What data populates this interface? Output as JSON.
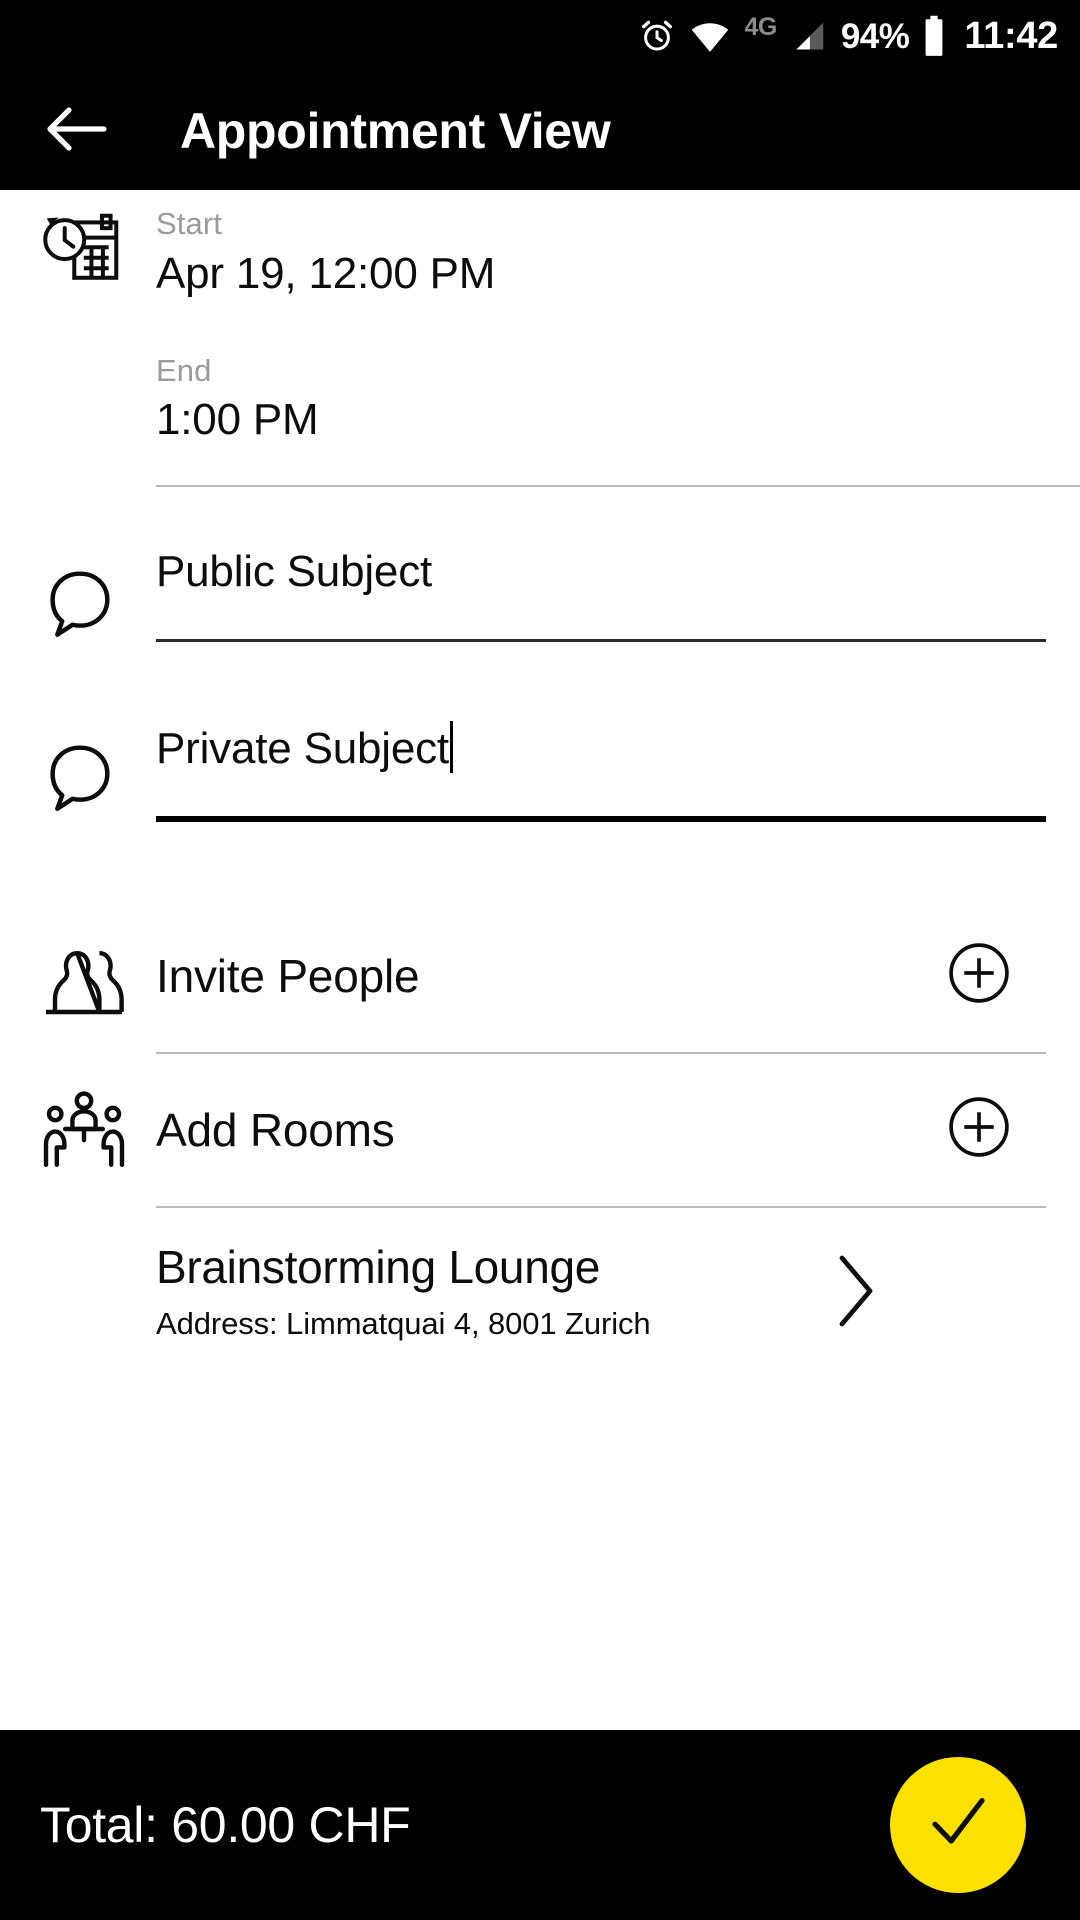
{
  "status_bar": {
    "alarm_icon": "alarm-clock-icon",
    "wifi_icon": "wifi-icon",
    "network_label": "4G",
    "signal_icon": "cellular-signal-icon",
    "battery_percent": "94%",
    "battery_icon": "battery-icon",
    "time": "11:42"
  },
  "app_bar": {
    "back_icon": "back-arrow-icon",
    "title": "Appointment View"
  },
  "schedule": {
    "icon": "calendar-clock-icon",
    "start_label": "Start",
    "start_value": "Apr 19, 12:00 PM",
    "end_label": "End",
    "end_value": "1:00 PM"
  },
  "public_subject": {
    "icon": "speech-bubble-icon",
    "value": "Public Subject",
    "placeholder": "Public Subject"
  },
  "private_subject": {
    "icon": "speech-bubble-icon",
    "value": "Private Subject",
    "placeholder": "Private Subject"
  },
  "invite_people": {
    "icon": "people-group-icon",
    "label": "Invite People",
    "add_icon": "plus-circle-icon"
  },
  "add_rooms": {
    "icon": "meeting-room-icon",
    "label": "Add Rooms",
    "add_icon": "plus-circle-icon"
  },
  "room": {
    "name": "Brainstorming Lounge",
    "address": "Address: Limmatquai 4, 8001 Zurich",
    "chevron_icon": "chevron-right-icon"
  },
  "bottom_bar": {
    "total": "Total: 60.00 CHF",
    "confirm_icon": "checkmark-icon",
    "accent_color": "#FBE000",
    "background_color": "#000000"
  }
}
